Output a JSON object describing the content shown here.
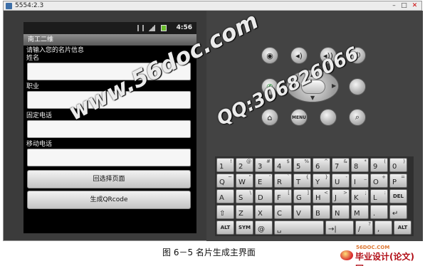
{
  "window": {
    "title": "5554:2.3",
    "min": "–",
    "max": "□",
    "close": "✕"
  },
  "status": {
    "time": "4:56"
  },
  "app": {
    "title": "南工二维"
  },
  "form": {
    "prompt": "请输入您的名片信息",
    "fields": [
      {
        "label": "姓名",
        "value": ""
      },
      {
        "label": "职业",
        "value": ""
      },
      {
        "label": "固定电话",
        "value": ""
      },
      {
        "label": "移动电话",
        "value": ""
      }
    ],
    "buttons": {
      "back": "回选择页面",
      "generate": "生成QRcode"
    }
  },
  "controls": {
    "camera_icon": "◉",
    "vol_down_icon": "◂)",
    "vol_up_icon": "◂))",
    "power_icon": "⏻",
    "call_icon": "✆",
    "home_icon": "⌂",
    "menu": "MENU",
    "search_icon": "⌕",
    "dpad": {
      "up": "▲",
      "down": "▼",
      "left": "◀",
      "right": "▶"
    }
  },
  "keyboard": {
    "rows": [
      [
        [
          "1",
          "!"
        ],
        [
          "2",
          "@"
        ],
        [
          "3",
          "#"
        ],
        [
          "4",
          "$"
        ],
        [
          "5",
          "%"
        ],
        [
          "6",
          "^"
        ],
        [
          "7",
          "&"
        ],
        [
          "8",
          "*"
        ],
        [
          "9",
          "("
        ],
        [
          "0",
          ")"
        ]
      ],
      [
        [
          "Q",
          "~"
        ],
        [
          "W",
          "\""
        ],
        [
          "E",
          "'"
        ],
        [
          "R",
          "`"
        ],
        [
          "T",
          "{"
        ],
        [
          "Y",
          "}"
        ],
        [
          "U",
          "-"
        ],
        [
          "I",
          "_"
        ],
        [
          "O",
          "+"
        ],
        [
          "P",
          "="
        ]
      ],
      [
        [
          "A",
          ""
        ],
        [
          "S",
          "\\"
        ],
        [
          "D",
          ""
        ],
        [
          "F",
          "["
        ],
        [
          "G",
          "]"
        ],
        [
          "H",
          "<"
        ],
        [
          "J",
          ">"
        ],
        [
          "K",
          ";"
        ],
        [
          "L",
          ":"
        ],
        [
          "DEL",
          ""
        ]
      ],
      [
        [
          "⇧",
          ""
        ],
        [
          "Z",
          ""
        ],
        [
          "X",
          ""
        ],
        [
          "C",
          ""
        ],
        [
          "V",
          ""
        ],
        [
          "B",
          ""
        ],
        [
          "N",
          ""
        ],
        [
          "M",
          ""
        ],
        [
          ".",
          ""
        ],
        [
          "↵",
          ""
        ]
      ],
      [
        [
          "ALT",
          ""
        ],
        [
          "SYM",
          ""
        ],
        [
          "@",
          ""
        ],
        [
          "␣",
          ""
        ],
        [
          "→|",
          ""
        ],
        [
          "/",
          "?"
        ],
        [
          ",",
          ""
        ],
        [
          "ALT",
          ""
        ]
      ]
    ]
  },
  "watermark": {
    "site": "www.56doc.com",
    "qq": "QQ:306826066"
  },
  "caption": "图 6－5 名片生成主界面",
  "logo": {
    "domain": "56DOC.COM",
    "text": "毕业设计(论文)网"
  }
}
